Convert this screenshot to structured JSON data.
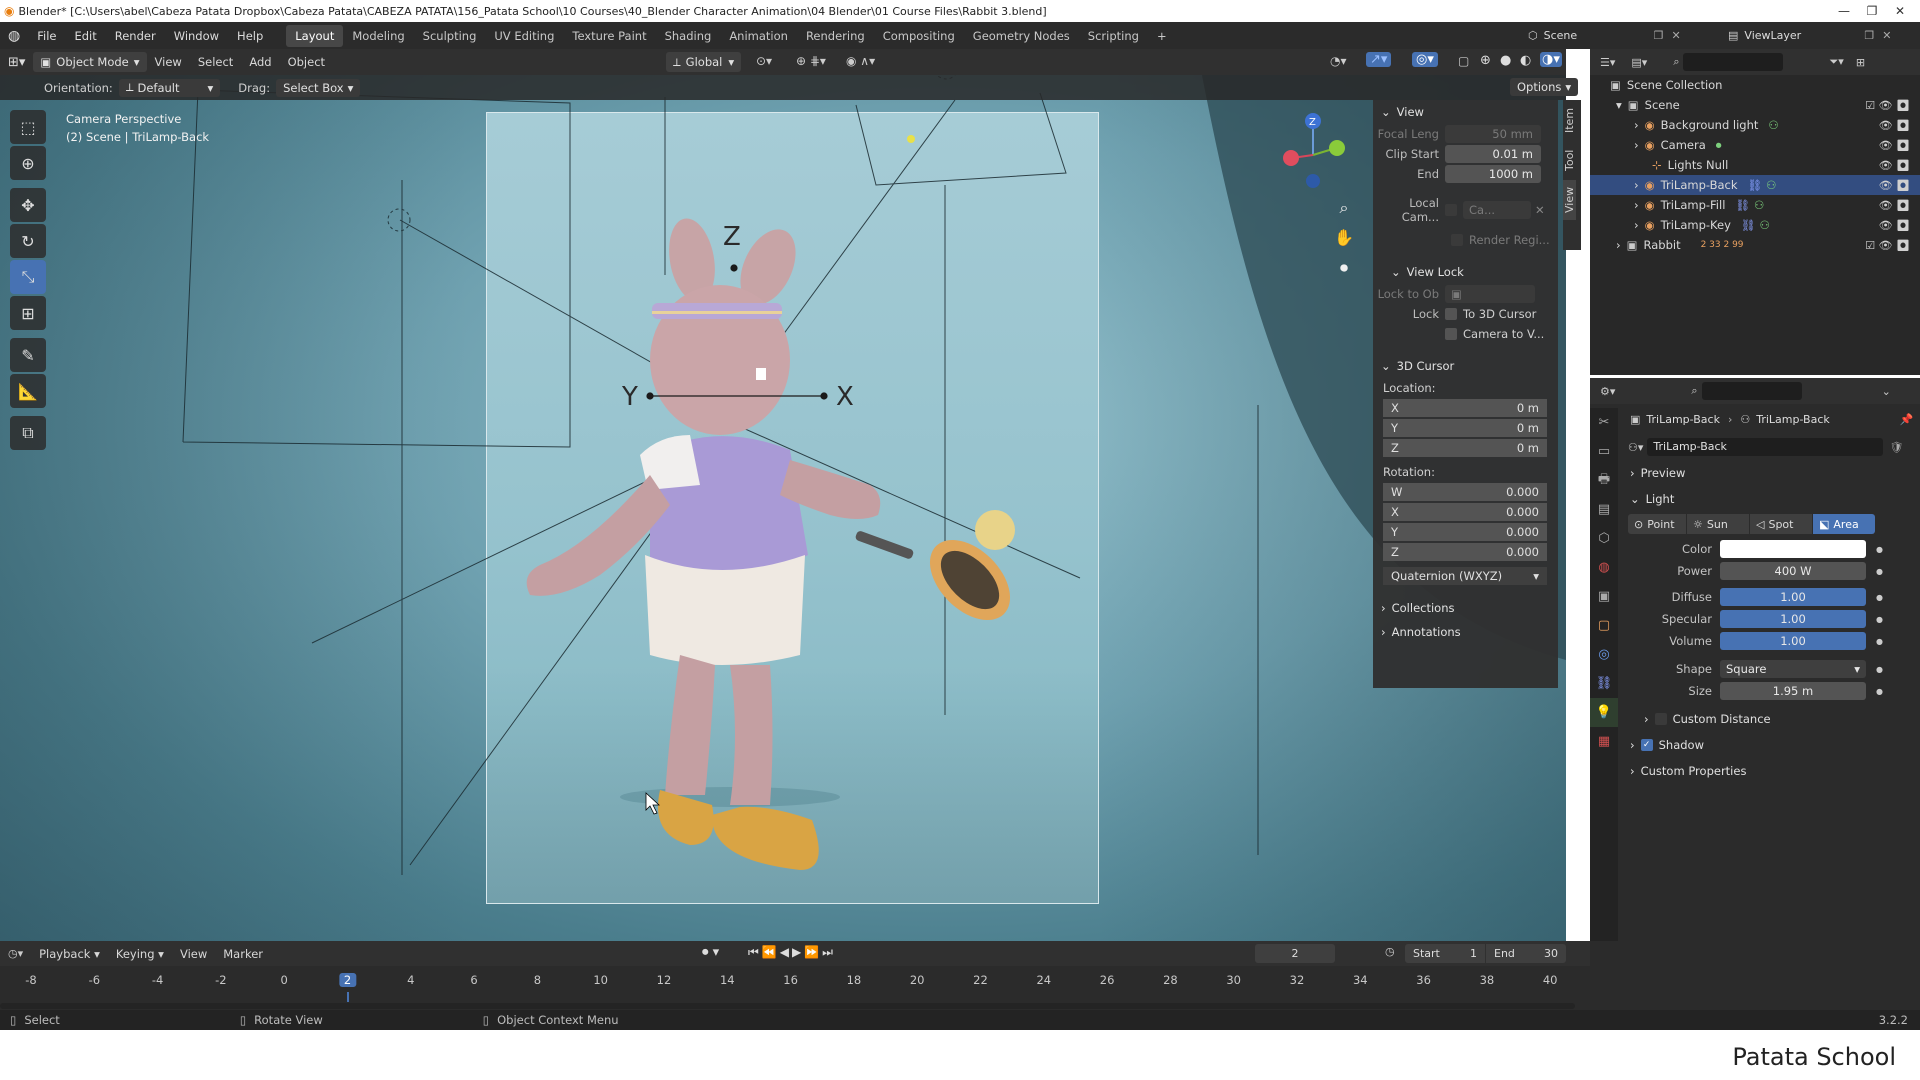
{
  "titlebar": {
    "title": "Blender* [C:\\Users\\abel\\Cabeza Patata Dropbox\\Cabeza Patata\\CABEZA PATATA\\156_Patata School\\10 Courses\\40_Blender Character Animation\\04 Blender\\01 Course Files\\Rabbit 3.blend]",
    "minimize": "—",
    "maximize": "❐",
    "close": "✕"
  },
  "menu": [
    "File",
    "Edit",
    "Render",
    "Window",
    "Help"
  ],
  "workspaces": [
    "Layout",
    "Modeling",
    "Sculpting",
    "UV Editing",
    "Texture Paint",
    "Shading",
    "Animation",
    "Rendering",
    "Compositing",
    "Geometry Nodes",
    "Scripting",
    "+"
  ],
  "scene_name": "Scene",
  "view_layer": "ViewLayer",
  "viewport_header": {
    "mode": "Object Mode",
    "menus": [
      "View",
      "Select",
      "Add",
      "Object"
    ],
    "transform": "Global"
  },
  "tool_header": {
    "orientation_label": "Orientation:",
    "orientation_value": "Default",
    "drag_label": "Drag:",
    "drag_value": "Select Box",
    "options": "Options"
  },
  "viewport": {
    "info_line1": "Camera Perspective",
    "info_line2": "(2) Scene | TriLamp-Back",
    "axis_x": "X",
    "axis_y": "Y",
    "axis_z": "Z"
  },
  "npanel": {
    "tabs": [
      "Item",
      "Tool",
      "View"
    ],
    "view_header": "View",
    "focal_label": "Focal Leng",
    "focal_value": "50 mm",
    "clip_start_label": "Clip Start",
    "clip_start_value": "0.01 m",
    "end_label": "End",
    "end_value": "1000 m",
    "local_cam_label": "Local Cam...",
    "local_cam_value": "Ca...",
    "render_region": "Render Regi...",
    "view_lock_header": "View Lock",
    "lock_to_obj": "Lock to Ob",
    "lock_label": "Lock",
    "to_3d_cursor": "To 3D Cursor",
    "camera_to_view": "Camera to V...",
    "cursor_header": "3D Cursor",
    "location_label": "Location:",
    "loc": [
      {
        "axis": "X",
        "value": "0 m"
      },
      {
        "axis": "Y",
        "value": "0 m"
      },
      {
        "axis": "Z",
        "value": "0 m"
      }
    ],
    "rotation_label": "Rotation:",
    "rot": [
      {
        "axis": "W",
        "value": "0.000"
      },
      {
        "axis": "X",
        "value": "0.000"
      },
      {
        "axis": "Y",
        "value": "0.000"
      },
      {
        "axis": "Z",
        "value": "0.000"
      }
    ],
    "rot_mode": "Quaternion (WXYZ)",
    "collections": "Collections",
    "annotations": "Annotations"
  },
  "outliner": {
    "root": "Scene Collection",
    "items": [
      {
        "name": "Scene",
        "level": 1
      },
      {
        "name": "Background light",
        "level": 2
      },
      {
        "name": "Camera",
        "level": 2
      },
      {
        "name": "Lights Null",
        "level": 2
      },
      {
        "name": "TriLamp-Back",
        "level": 2,
        "selected": true
      },
      {
        "name": "TriLamp-Fill",
        "level": 2
      },
      {
        "name": "TriLamp-Key",
        "level": 2
      },
      {
        "name": "Rabbit",
        "level": 1
      }
    ],
    "rabbit_badges": "2  33  2  99"
  },
  "properties": {
    "breadcrumb_object": "TriLamp-Back",
    "breadcrumb_data": "TriLamp-Back",
    "datablock": "TriLamp-Back",
    "preview": "Preview",
    "light_header": "Light",
    "light_types": [
      "Point",
      "Sun",
      "Spot",
      "Area"
    ],
    "active_type": "Area",
    "color_label": "Color",
    "power_label": "Power",
    "power_value": "400 W",
    "diffuse_label": "Diffuse",
    "diffuse_value": "1.00",
    "specular_label": "Specular",
    "specular_value": "1.00",
    "volume_label": "Volume",
    "volume_value": "1.00",
    "shape_label": "Shape",
    "shape_value": "Square",
    "size_label": "Size",
    "size_value": "1.95 m",
    "custom_distance": "Custom Distance",
    "shadow": "Shadow",
    "custom_properties": "Custom Properties",
    "light_color": "#ffffff"
  },
  "timeline": {
    "menus": [
      "Playback",
      "Keying",
      "View",
      "Marker"
    ],
    "current_frame": "2",
    "start_label": "Start",
    "start_value": "1",
    "end_label": "End",
    "end_value": "30",
    "ticks": [
      "-8",
      "-6",
      "-4",
      "-2",
      "0",
      "2",
      "4",
      "6",
      "8",
      "10",
      "12",
      "14",
      "16",
      "18",
      "20",
      "22",
      "24",
      "26",
      "28",
      "30",
      "32",
      "34",
      "36",
      "38",
      "40"
    ]
  },
  "statusbar": {
    "select": "Select",
    "rotate": "Rotate View",
    "context": "Object Context Menu",
    "version": "3.2.2"
  },
  "footer_brand": "Patata School",
  "colors": {
    "accent": "#4772b3",
    "selected_row": "#334d80",
    "panel": "#303030"
  }
}
